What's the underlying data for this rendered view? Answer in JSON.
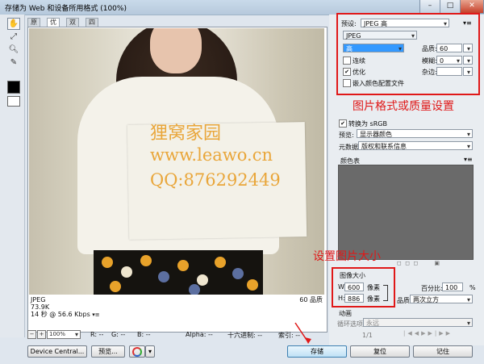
{
  "window": {
    "title": "存储为 Web 和设备所用格式 (100%)",
    "min": "–",
    "max": "□",
    "close": "✕"
  },
  "tabs": [
    {
      "label": "原稿"
    },
    {
      "label": "优化"
    },
    {
      "label": "双联"
    },
    {
      "label": "四联"
    }
  ],
  "watermark": {
    "line1": "狸窝家园",
    "line2": "www.leawo.cn",
    "line3": "QQ:876292449"
  },
  "image_info": {
    "format": "JPEG",
    "size": "73.9K",
    "time": "14 秒 @ 56.6 Kbps",
    "quality": "60 品质"
  },
  "statusbar": {
    "zoom": "100%",
    "r": "R: --",
    "g": "G: --",
    "b": "B: --",
    "alpha": "Alpha: --",
    "hex": "十六进制: --",
    "index": "索引: --"
  },
  "buttons": {
    "device_central": "Device Central...",
    "preview": "预览...",
    "save": "存储",
    "reset": "复位",
    "remember": "记住"
  },
  "settings": {
    "preset_label": "预设:",
    "preset_value": "JPEG 高",
    "format": "JPEG",
    "quality_preset": "高",
    "quality_label": "品质:",
    "quality_value": "60",
    "progressive": "连续",
    "blur_label": "模糊:",
    "blur_value": "0",
    "optimized": "优化",
    "matte_label": "杂边:",
    "embed_profile": "嵌入颜色配置文件",
    "annotation": "图片格式或质量设置"
  },
  "color": {
    "convert_srgb": "转换为 sRGB",
    "preview_label": "预览:",
    "preview_value": "显示器颜色",
    "metadata_label": "元数据:",
    "metadata_value": "版权和联系信息",
    "color_table_label": "颜色表"
  },
  "image_size": {
    "annotation": "设置图片大小",
    "title": "图像大小",
    "w_label": "W:",
    "w_value": "600",
    "h_label": "H:",
    "h_value": "886",
    "unit": "像素",
    "percent_label": "百分比:",
    "percent_value": "100",
    "percent_unit": "%",
    "quality_label": "品质:",
    "quality_value": "两次立方"
  },
  "animation": {
    "title": "动画",
    "loop_label": "循环选项:",
    "loop_value": "永远",
    "frame": "1/1"
  }
}
